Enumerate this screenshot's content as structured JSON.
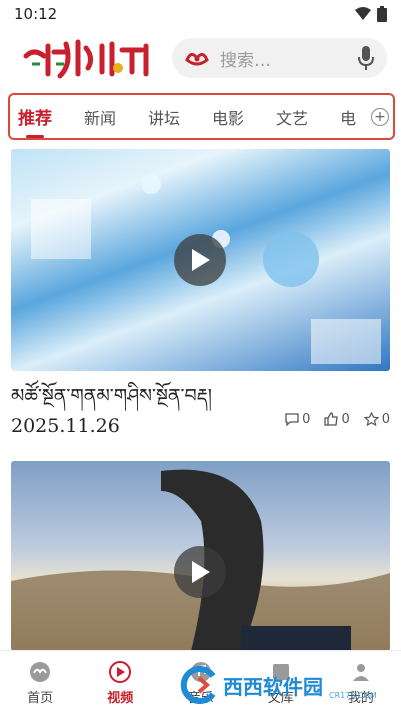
{
  "status_bar": {
    "time": "10:12"
  },
  "header": {
    "logo_text": "འཇའ་ཚོན།",
    "search_placeholder": "搜索…"
  },
  "tabs": [
    {
      "label": "推荐",
      "active": true
    },
    {
      "label": "新闻",
      "active": false
    },
    {
      "label": "讲坛",
      "active": false
    },
    {
      "label": "电影",
      "active": false
    },
    {
      "label": "文艺",
      "active": false
    },
    {
      "label": "电",
      "active": false
    }
  ],
  "cards": [
    {
      "title": "མཚོ་སྔོན་གནམ་གཤིས་སྔོན་བརྡ། 2025.11.26",
      "comments": "0",
      "likes": "0",
      "stars": "0"
    },
    {
      "title": ""
    }
  ],
  "bottom_nav": [
    {
      "label": "首页",
      "icon": "home-icon"
    },
    {
      "label": "视频",
      "icon": "video-icon",
      "active": true
    },
    {
      "label": "音乐",
      "icon": "music-icon"
    },
    {
      "label": "文库",
      "icon": "library-icon"
    },
    {
      "label": "我的",
      "icon": "profile-icon"
    }
  ],
  "watermark": {
    "brand": "西西软件园",
    "url": "CR173.COM"
  },
  "colors": {
    "accent": "#c8202e",
    "tab_border": "#d94a3a"
  }
}
